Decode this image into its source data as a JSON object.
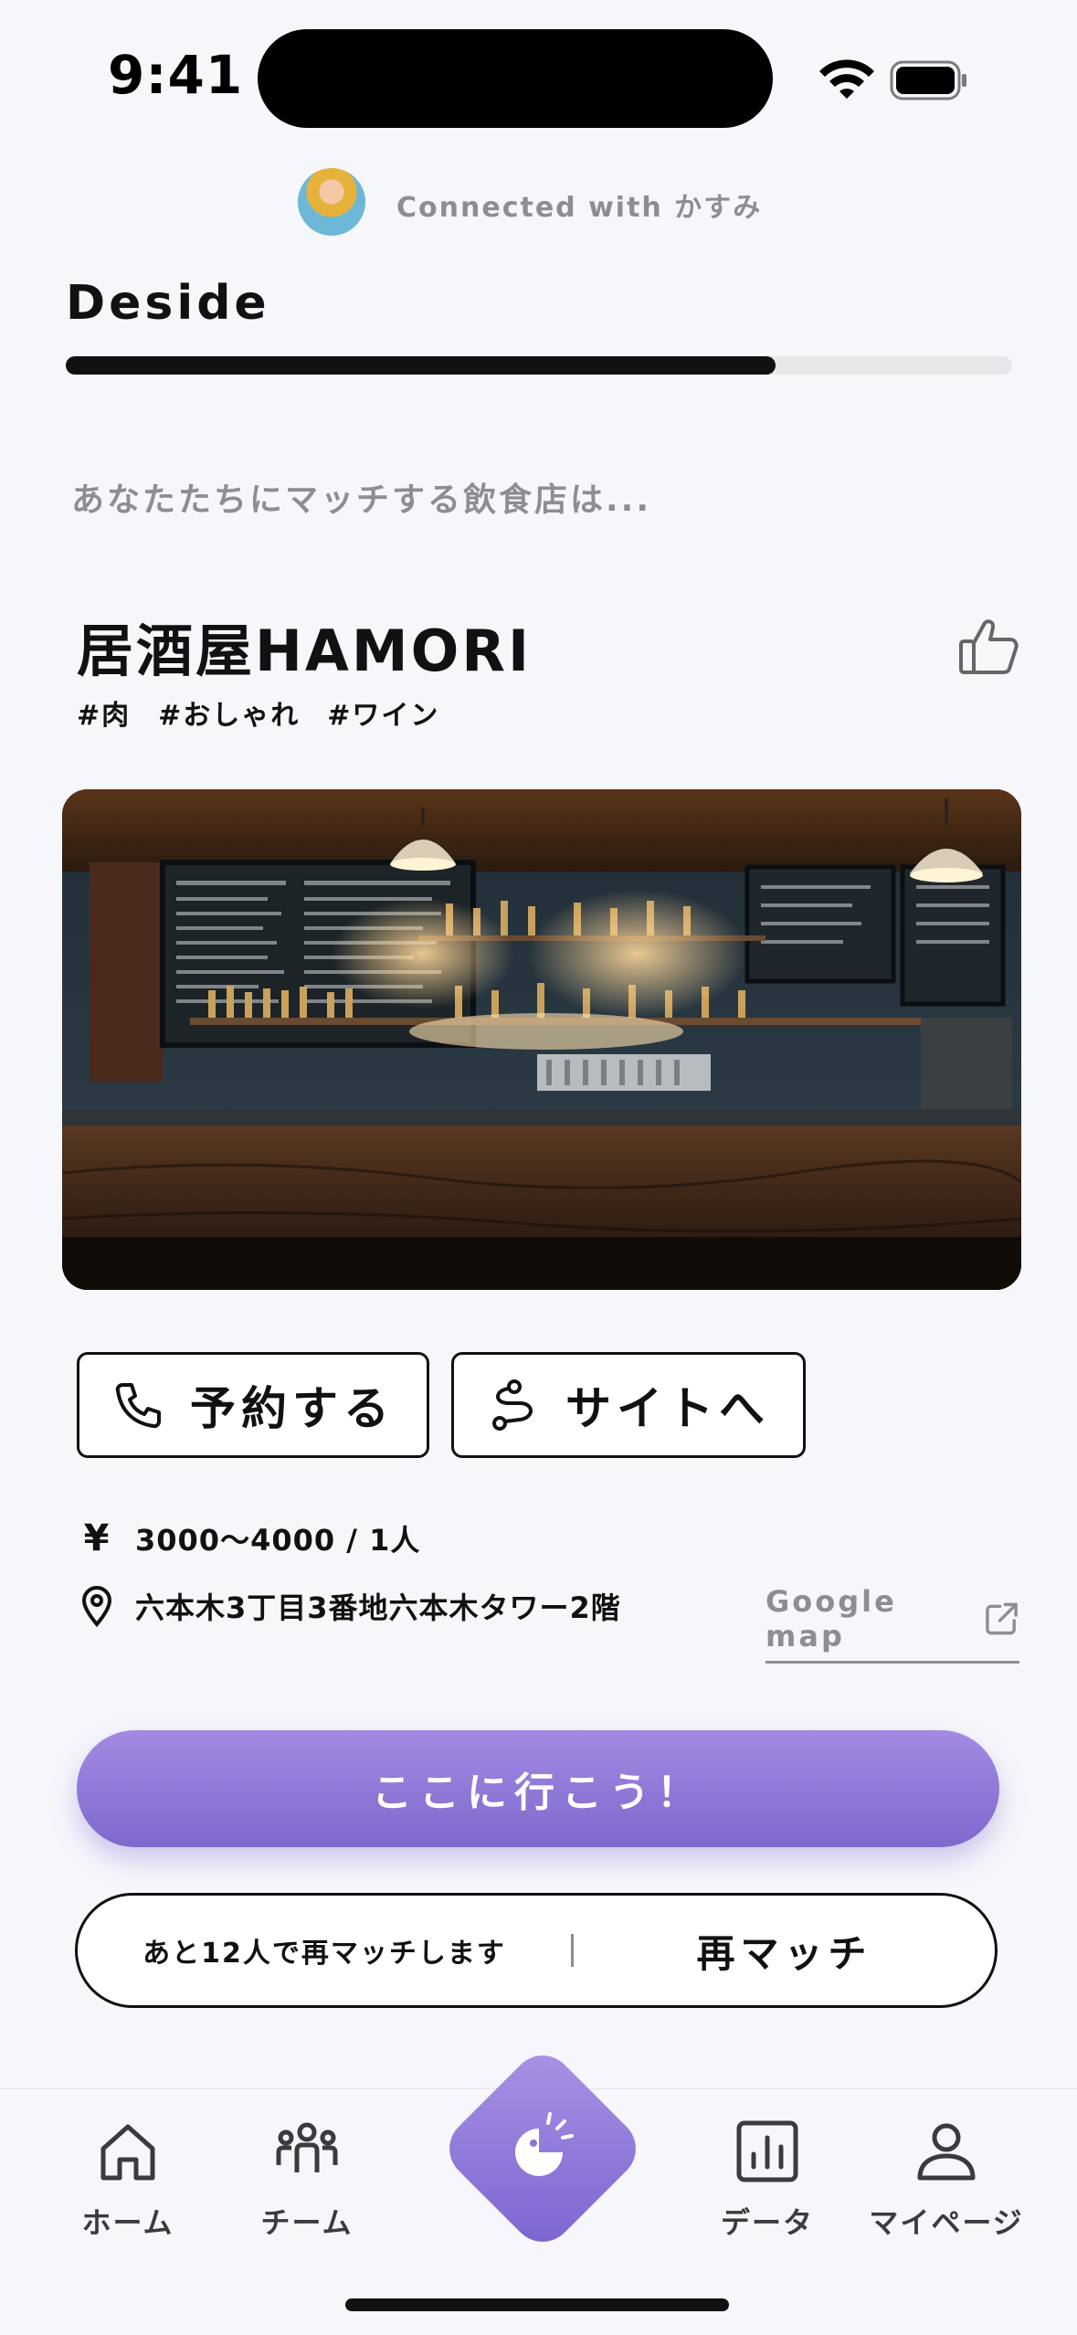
{
  "status_bar": {
    "time": "9:41"
  },
  "connection": {
    "text": "Connected with かすみ"
  },
  "header": {
    "title": "Deside",
    "progress": 0.75
  },
  "main": {
    "subtitle": "あなたたちにマッチする飲食店は...",
    "restaurant": {
      "name": "居酒屋HAMORI",
      "tags": [
        "#肉",
        "#おしゃれ",
        "#ワイン"
      ],
      "price": "3000〜4000 / 1人",
      "address": "六本木3丁目3番地六本木タワー2階",
      "map_link": "Google map"
    },
    "buttons": {
      "reserve": "予約する",
      "site": "サイトへ",
      "go": "ここに行こう！",
      "rematch_note": "あと12人で再マッチします",
      "rematch": "再マッチ"
    }
  },
  "tabbar": {
    "home": "ホーム",
    "team": "チーム",
    "data": "データ",
    "mypage": "マイページ"
  },
  "colors": {
    "accent": "#8c74d8",
    "text": "#111111",
    "muted": "#8d8d94",
    "background": "#f6f7fb"
  }
}
